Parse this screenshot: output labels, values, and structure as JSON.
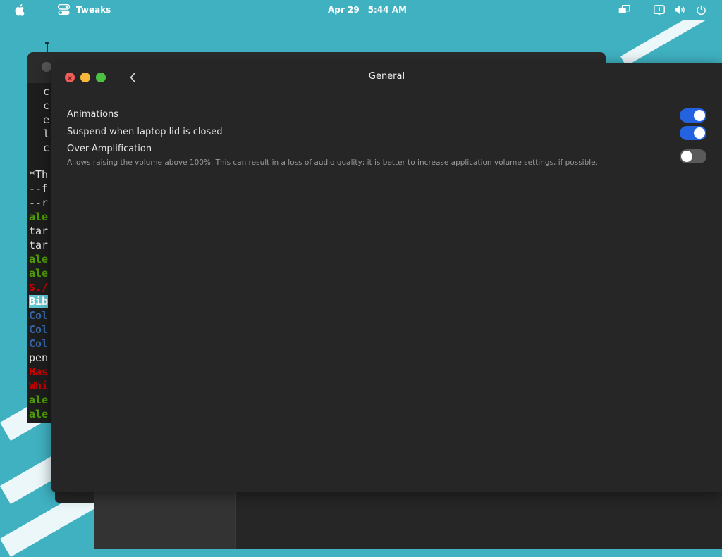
{
  "topbar": {
    "app_name": "Tweaks",
    "date": "Apr 29",
    "time": "5:44 AM"
  },
  "terminal": {
    "lines": [
      {
        "text": "c",
        "color": "white"
      },
      {
        "text": "c",
        "color": "white"
      },
      {
        "text": "e",
        "color": "white"
      },
      {
        "text": "l",
        "color": "white"
      },
      {
        "text": "c",
        "color": "white"
      },
      {
        "text": "",
        "color": "white"
      },
      {
        "text": "*Th",
        "color": "white"
      },
      {
        "text": "--f",
        "color": "white"
      },
      {
        "text": "--r",
        "color": "white"
      },
      {
        "text": "ale",
        "color": "green"
      },
      {
        "text": "tar",
        "color": "white"
      },
      {
        "text": "tar",
        "color": "white"
      },
      {
        "text": "ale",
        "color": "green"
      },
      {
        "text": "ale",
        "color": "green"
      },
      {
        "text": "$./",
        "color": "red"
      },
      {
        "text": "Bib",
        "color": "hl"
      },
      {
        "text": "Col",
        "color": "blue"
      },
      {
        "text": "Col",
        "color": "blue"
      },
      {
        "text": "Col",
        "color": "blue"
      },
      {
        "text": "pen",
        "color": "white"
      },
      {
        "text": "Has",
        "color": "red"
      },
      {
        "text": "Whi",
        "color": "red"
      },
      {
        "text": "ale",
        "color": "green"
      },
      {
        "text": "ale",
        "color": "green"
      }
    ]
  },
  "window": {
    "title": "General",
    "settings": [
      {
        "label": "Animations",
        "enabled": true
      },
      {
        "label": "Suspend when laptop lid is closed",
        "enabled": true
      },
      {
        "label": "Over-Amplification",
        "description": "Allows raising the volume above 100%. This can result in a loss of audio quality; it is better to increase application volume settings, if possible.",
        "enabled": false
      }
    ]
  },
  "colors": {
    "wallpaper": "#3fb1c1",
    "window_bg": "#262626",
    "toggle_on": "#2463e0",
    "toggle_off": "#5a5a5a",
    "close": "#ec5f5d",
    "minimize": "#f5b83b",
    "maximize": "#4cc243"
  },
  "icons": {
    "apple": "apple-icon",
    "tweaks": "toggles-icon",
    "display": "display-icon",
    "notification": "notification-icon",
    "volume": "volume-icon",
    "power": "power-icon",
    "back": "chevron-left-icon"
  }
}
